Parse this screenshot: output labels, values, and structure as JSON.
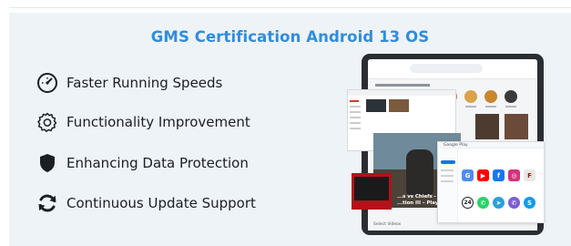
{
  "section": {
    "title": "GMS Certification Android 13 OS"
  },
  "features": [
    {
      "label": "Faster Running Speeds",
      "icon": "speedometer-icon"
    },
    {
      "label": "Functionality Improvement",
      "icon": "gear-icon"
    },
    {
      "label": "Enhancing Data Protection",
      "icon": "shield-icon"
    },
    {
      "label": "Continuous Update Support",
      "icon": "refresh-icon"
    }
  ],
  "tablet_screen": {
    "video_caption_line1": "...s vs Chiefs - 3 Ma...",
    "video_caption_line2": "...tion III – Playoffs",
    "footer_text": "Select Videos",
    "store_title": "Google Play",
    "app_badge_number": "24"
  },
  "colors": {
    "accent": "#2f8de0",
    "panel_background": "#eef3f8",
    "text": "#1b1f24"
  }
}
